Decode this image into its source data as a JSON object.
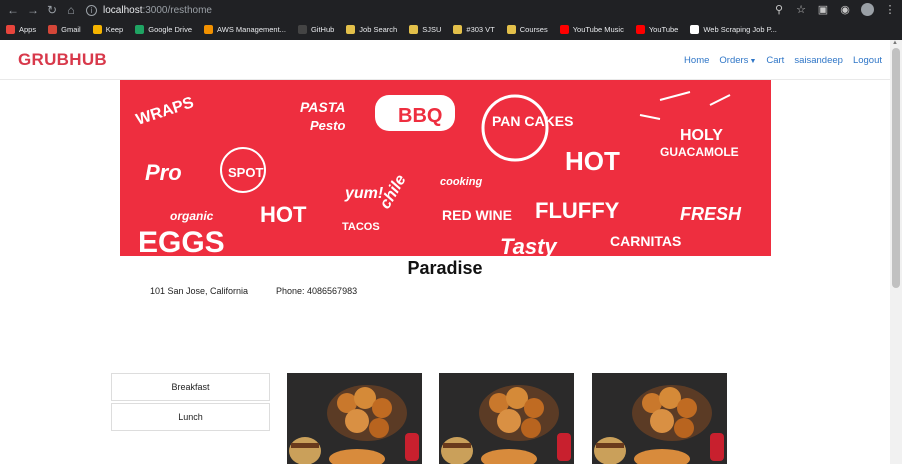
{
  "browser": {
    "url_host": "localhost",
    "url_rest": ":3000/resthome",
    "bookmarks": [
      {
        "label": "Apps",
        "color": "#e8453c"
      },
      {
        "label": "Gmail",
        "color": "#d44638"
      },
      {
        "label": "Keep",
        "color": "#f5b400"
      },
      {
        "label": "Google Drive",
        "color": "#1fa463"
      },
      {
        "label": "AWS Management...",
        "color": "#f29100"
      },
      {
        "label": "GitHub",
        "color": "#444444"
      },
      {
        "label": "Job Search",
        "color": "#e3c04a"
      },
      {
        "label": "SJSU",
        "color": "#e3c04a"
      },
      {
        "label": "#303 VT",
        "color": "#e3c04a"
      },
      {
        "label": "Courses",
        "color": "#e3c04a"
      },
      {
        "label": "YouTube Music",
        "color": "#ff0000"
      },
      {
        "label": "YouTube",
        "color": "#ff0000"
      },
      {
        "label": "Web Scraping Job P...",
        "color": "#ffffff"
      }
    ]
  },
  "navbar": {
    "brand": "GRUBHUB",
    "links": {
      "home": "Home",
      "orders": "Orders",
      "cart": "Cart",
      "user": "saisandeep",
      "logout": "Logout"
    }
  },
  "banner": {
    "words": [
      "WRAPS",
      "PASTA",
      "Pesto",
      "BBQ",
      "PAN CAKES",
      "HOLY",
      "GUACAMOLE",
      "Pro",
      "SPOT",
      "HOT",
      "yum!",
      "TACOS",
      "RED WINE",
      "FLUFFY",
      "FRESH",
      "organic",
      "EGGS",
      "HOT",
      "CARNITAS",
      "Tasty",
      "chile",
      "cooking"
    ]
  },
  "restaurant": {
    "name": "Paradise",
    "address": "101 San Jose, California",
    "phone": "Phone: 4086567983"
  },
  "menu": {
    "categories": [
      "Breakfast",
      "Lunch"
    ]
  },
  "colors": {
    "brand": "#d8394b",
    "link": "#2f76c7",
    "banner": "#ee2e3f"
  }
}
